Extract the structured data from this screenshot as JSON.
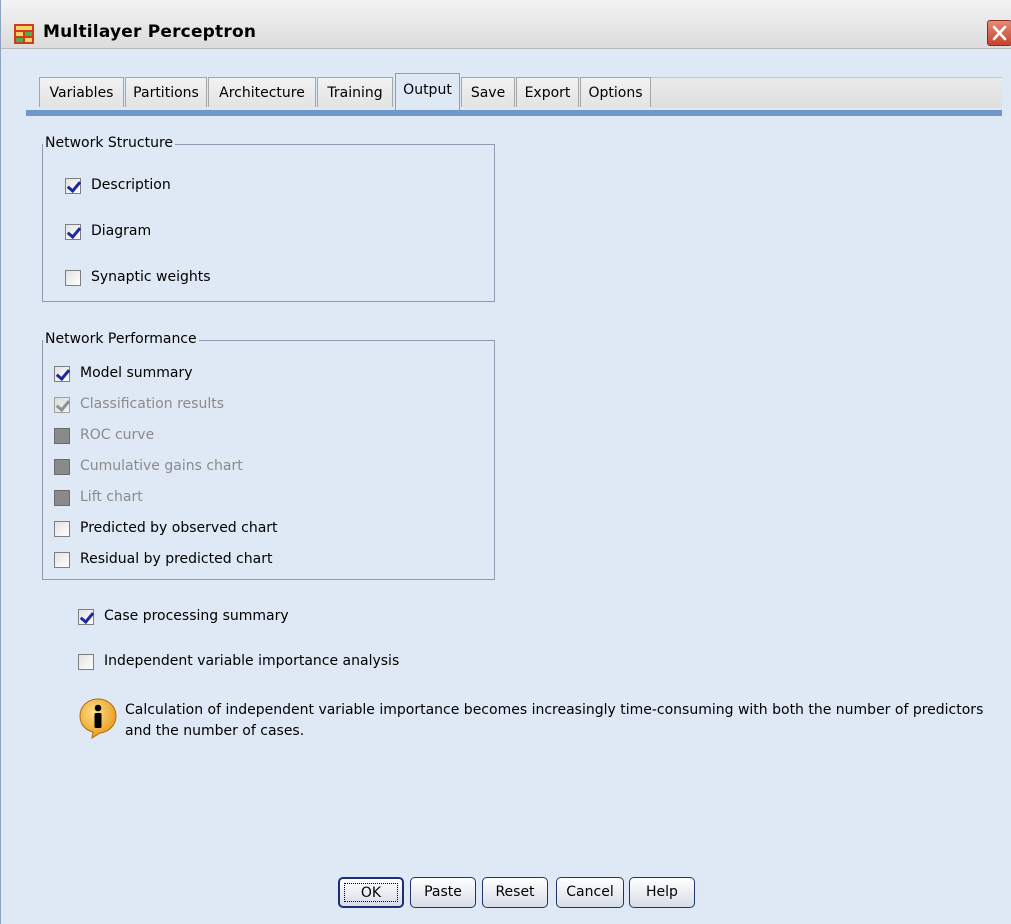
{
  "window": {
    "title": "Multilayer Perceptron"
  },
  "tabs": [
    {
      "label": "Variables",
      "active": false
    },
    {
      "label": "Partitions",
      "active": false
    },
    {
      "label": "Architecture",
      "active": false
    },
    {
      "label": "Training",
      "active": false
    },
    {
      "label": "Output",
      "active": true
    },
    {
      "label": "Save",
      "active": false
    },
    {
      "label": "Export",
      "active": false
    },
    {
      "label": "Options",
      "active": false
    }
  ],
  "network_structure": {
    "title": "Network Structure",
    "items": [
      {
        "label": "Description",
        "checked": true,
        "enabled": true
      },
      {
        "label": "Diagram",
        "checked": true,
        "enabled": true
      },
      {
        "label": "Synaptic weights",
        "checked": false,
        "enabled": true
      }
    ]
  },
  "network_performance": {
    "title": "Network Performance",
    "items": [
      {
        "label": "Model summary",
        "checked": true,
        "enabled": true
      },
      {
        "label": "Classification results",
        "checked": true,
        "enabled": false
      },
      {
        "label": "ROC curve",
        "checked": false,
        "enabled": false
      },
      {
        "label": "Cumulative gains chart",
        "checked": false,
        "enabled": false
      },
      {
        "label": "Lift chart",
        "checked": false,
        "enabled": false
      },
      {
        "label": "Predicted by observed chart",
        "checked": false,
        "enabled": true
      },
      {
        "label": "Residual by predicted chart",
        "checked": false,
        "enabled": true
      }
    ]
  },
  "extra_options": [
    {
      "label": "Case processing summary",
      "checked": true,
      "enabled": true
    },
    {
      "label": "Independent variable importance analysis",
      "checked": false,
      "enabled": true
    }
  ],
  "info_note": "Calculation of independent variable importance becomes increasingly time-consuming with both the number of predictors and the number of cases.",
  "buttons": [
    {
      "label": "OK",
      "default": true
    },
    {
      "label": "Paste",
      "default": false
    },
    {
      "label": "Reset",
      "default": false
    },
    {
      "label": "Cancel",
      "default": false
    },
    {
      "label": "Help",
      "default": false
    }
  ],
  "icons": {
    "app": "spreadsheet-grid-icon",
    "close": "close-icon",
    "info": "info-icon"
  },
  "colors": {
    "accent_bar": "#6f97c9",
    "close": "#c4452f",
    "panel": "#dfe9f5"
  }
}
